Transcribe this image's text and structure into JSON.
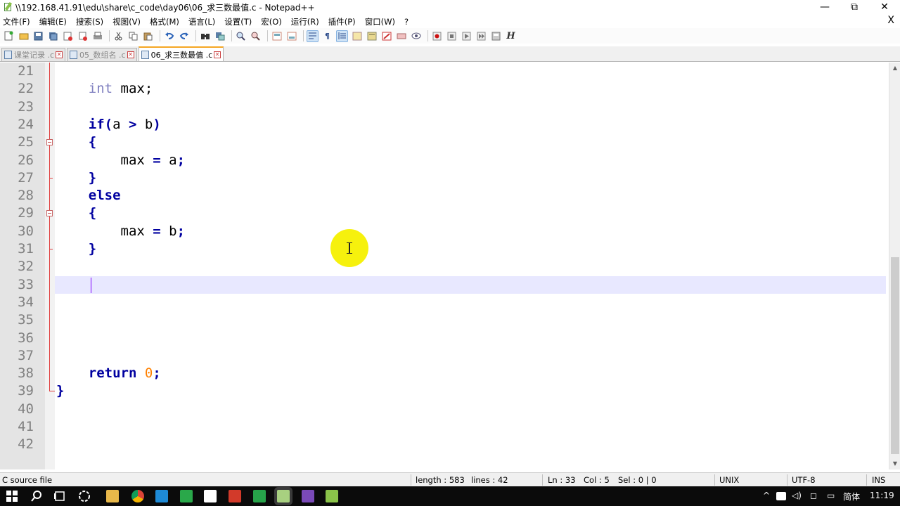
{
  "window": {
    "title": "\\\\192.168.41.91\\edu\\share\\c_code\\day06\\06_求三数最值.c - Notepad++",
    "minimize": "—",
    "restore": "⧉",
    "close": "✕"
  },
  "menu": {
    "items": [
      "文件(F)",
      "编辑(E)",
      "搜索(S)",
      "视图(V)",
      "格式(M)",
      "语言(L)",
      "设置(T)",
      "宏(O)",
      "运行(R)",
      "插件(P)",
      "窗口(W)",
      "?"
    ],
    "close": "X"
  },
  "toolbar": {
    "icons": [
      "new-file-icon",
      "open-file-icon",
      "save-icon",
      "save-all-icon",
      "close-icon",
      "close-all-icon",
      "print-icon",
      "cut-icon",
      "copy-icon",
      "paste-icon",
      "undo-icon",
      "redo-icon",
      "find-icon",
      "replace-icon",
      "zoom-in-icon",
      "zoom-out-icon",
      "sync-vertical-icon",
      "sync-horizontal-icon",
      "word-wrap-icon",
      "show-all-chars-icon",
      "indent-guide-icon",
      "document-map-icon",
      "function-list-icon",
      "folder-workspace-icon",
      "monitor-icon",
      "eye-icon",
      "record-macro-icon",
      "stop-macro-icon",
      "play-macro-icon",
      "run-macro-multiple-icon",
      "save-macro-icon",
      "spell-check-icon"
    ],
    "bold_h": "H"
  },
  "tabs": [
    {
      "label": "课堂记录 .c",
      "active": false
    },
    {
      "label": "05_数组名 .c",
      "active": false
    },
    {
      "label": "06_求三数最值 .c",
      "active": true
    }
  ],
  "editor": {
    "lines": [
      {
        "n": "21",
        "code": ""
      },
      {
        "n": "22",
        "code": "    int max;"
      },
      {
        "n": "23",
        "code": ""
      },
      {
        "n": "24",
        "code": "    if(a > b)"
      },
      {
        "n": "25",
        "code": "    {"
      },
      {
        "n": "26",
        "code": "        max = a;"
      },
      {
        "n": "27",
        "code": "    }"
      },
      {
        "n": "28",
        "code": "    else"
      },
      {
        "n": "29",
        "code": "    {"
      },
      {
        "n": "30",
        "code": "        max = b;"
      },
      {
        "n": "31",
        "code": "    }"
      },
      {
        "n": "32",
        "code": ""
      },
      {
        "n": "33",
        "code": ""
      },
      {
        "n": "34",
        "code": ""
      },
      {
        "n": "35",
        "code": ""
      },
      {
        "n": "36",
        "code": ""
      },
      {
        "n": "37",
        "code": ""
      },
      {
        "n": "38",
        "code": "    return 0;"
      },
      {
        "n": "39",
        "code": "}"
      },
      {
        "n": "40",
        "code": ""
      },
      {
        "n": "41",
        "code": ""
      },
      {
        "n": "42",
        "code": ""
      }
    ],
    "current_line": "33"
  },
  "status": {
    "file_type": "C source file",
    "length": "length : 583",
    "lines": "lines : 42",
    "ln": "Ln : 33",
    "col": "Col : 5",
    "sel": "Sel : 0 | 0",
    "eol": "UNIX",
    "encoding": "UTF-8",
    "mode": "INS"
  },
  "taskbar": {
    "ime": "简体",
    "time": "11:19"
  },
  "colors": {
    "keyword_type": "#8080c0",
    "keyword_control": "#0000a0",
    "number": "#ff8000",
    "current_line": "#e8e8ff",
    "fold_line": "#e04040"
  }
}
